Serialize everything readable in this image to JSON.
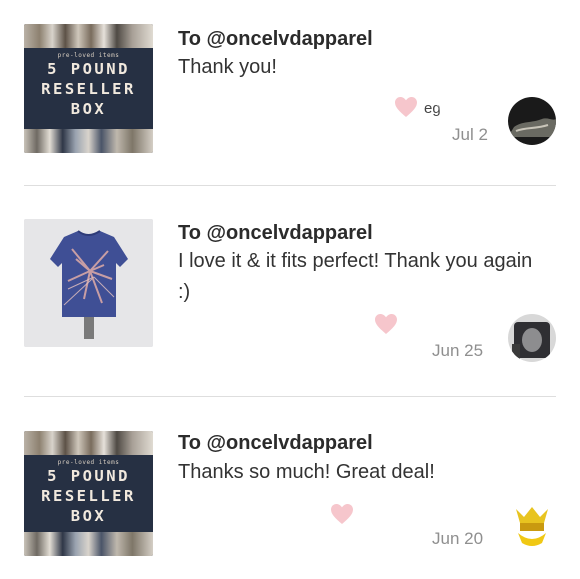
{
  "reviews": [
    {
      "thumbnail": {
        "type": "reseller-box",
        "small_text": "pre-loved items",
        "line1": "5 POUND",
        "line2": "RESELLER",
        "line3": "BOX"
      },
      "to": "To @oncelvdapparel",
      "message": "Thank you!",
      "username_fragment": "eg",
      "date": "Jul 2"
    },
    {
      "thumbnail": {
        "type": "tie-dye-shirt"
      },
      "to": "To @oncelvdapparel",
      "message": "I love it & it fits perfect! Thank you again :)",
      "username_fragment": "",
      "date": "Jun 25"
    },
    {
      "thumbnail": {
        "type": "reseller-box",
        "small_text": "pre-loved items",
        "line1": "5 POUND",
        "line2": "RESELLER",
        "line3": "BOX"
      },
      "to": "To @oncelvdapparel",
      "message": "Thanks so much! Great deal!",
      "username_fragment": "",
      "date": "Jun 20"
    }
  ],
  "colors": {
    "heart": "#f6c6cc",
    "divider": "#dedede",
    "date": "#8f8f8f"
  },
  "icons": {
    "like": "heart-icon"
  }
}
